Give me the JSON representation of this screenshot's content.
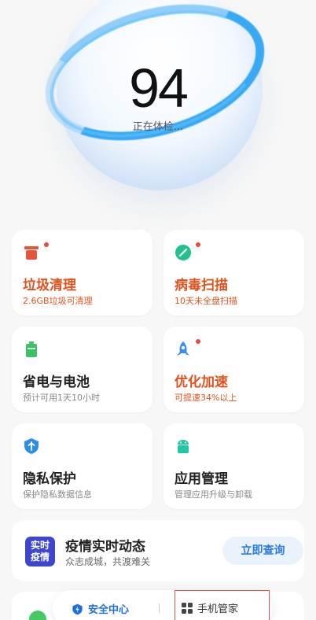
{
  "header": {
    "score": "94",
    "status": "正在体检..."
  },
  "cards": [
    {
      "title": "垃圾清理",
      "subtitle": "2.6GB垃圾可清理",
      "icon": "trash-icon",
      "alert": true,
      "color": "#e8543a"
    },
    {
      "title": "病毒扫描",
      "subtitle": "10天未全盘扫描",
      "icon": "shield-scan-icon",
      "alert": true,
      "color": "#21c28e"
    },
    {
      "title": "省电与电池",
      "subtitle": "预计可用1天10小时",
      "icon": "battery-icon",
      "alert": false,
      "color": "#3cc06a"
    },
    {
      "title": "优化加速",
      "subtitle": "可提速34%以上",
      "icon": "rocket-icon",
      "alert": true,
      "color": "#3a8fee"
    },
    {
      "title": "隐私保护",
      "subtitle": "保护隐私数据信息",
      "icon": "privacy-shield-icon",
      "alert": false,
      "color": "#2b8ee8"
    },
    {
      "title": "应用管理",
      "subtitle": "管理应用升级与卸载",
      "icon": "android-icon",
      "alert": false,
      "color": "#22c7a6"
    }
  ],
  "banner": {
    "logo_line1": "实时",
    "logo_line2": "疫情",
    "title": "疫情实时动态",
    "subtitle": "众志成城，共渡难关",
    "button": "立即查询"
  },
  "bottom_bar": {
    "left_label": "安全中心",
    "right_label": "手机管家"
  }
}
